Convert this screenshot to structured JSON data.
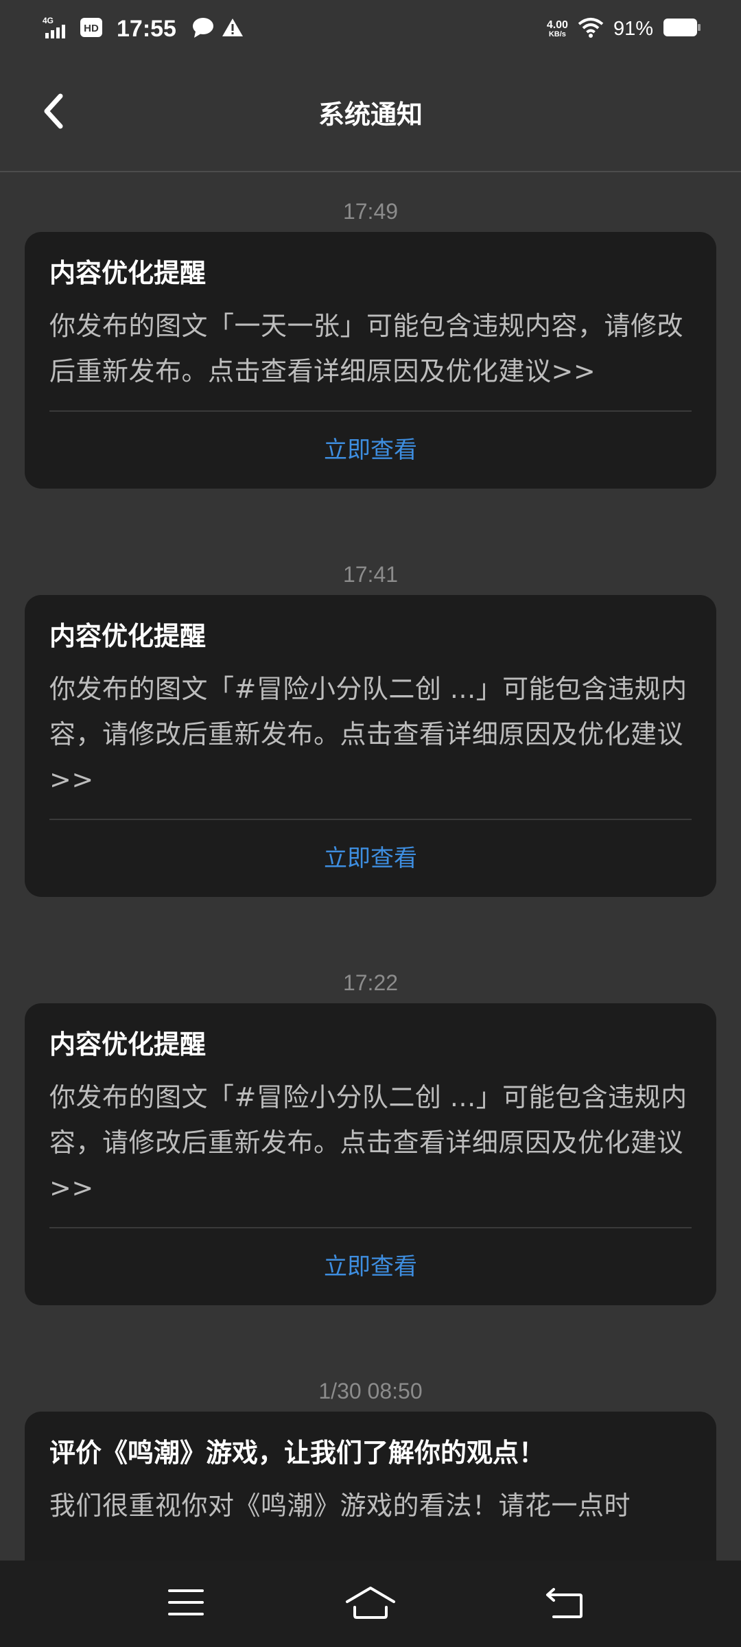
{
  "status_bar": {
    "network": "4G",
    "hd_badge": "HD",
    "time": "17:55",
    "net_speed_value": "4.00",
    "net_speed_unit": "KB/s",
    "battery_percent": "91%",
    "icons": [
      "signal-icon",
      "hd-icon",
      "chat-bubble-icon",
      "warning-icon",
      "wifi-icon",
      "battery-icon"
    ]
  },
  "header": {
    "title": "系统通知",
    "back_icon": "chevron-left-icon"
  },
  "notifications": [
    {
      "timestamp": "17:49",
      "title": "内容优化提醒",
      "body": "你发布的图文「一天一张」可能包含违规内容，请修改后重新发布。点击查看详细原因及优化建议>>",
      "action": "立即查看"
    },
    {
      "timestamp": "17:41",
      "title": "内容优化提醒",
      "body": "你发布的图文「#冒险小分队二创 ...」可能包含违规内容，请修改后重新发布。点击查看详细原因及优化建议>>",
      "action": "立即查看"
    },
    {
      "timestamp": "17:22",
      "title": "内容优化提醒",
      "body": "你发布的图文「#冒险小分队二创 ...」可能包含违规内容，请修改后重新发布。点击查看详细原因及优化建议>>",
      "action": "立即查看"
    },
    {
      "timestamp": "1/30  08:50",
      "title": "评价《鸣潮》游戏，让我们了解你的观点！",
      "body": "我们很重视你对《鸣潮》游戏的看法！请花一点时"
    }
  ],
  "nav_bar": {
    "icons": [
      "menu-icon",
      "home-icon",
      "back-icon"
    ]
  },
  "colors": {
    "background": "#353535",
    "card": "#1c1c1c",
    "accent": "#3e8ee0",
    "timestamp": "#8c8c8c",
    "body_text": "#bdbdbd"
  }
}
